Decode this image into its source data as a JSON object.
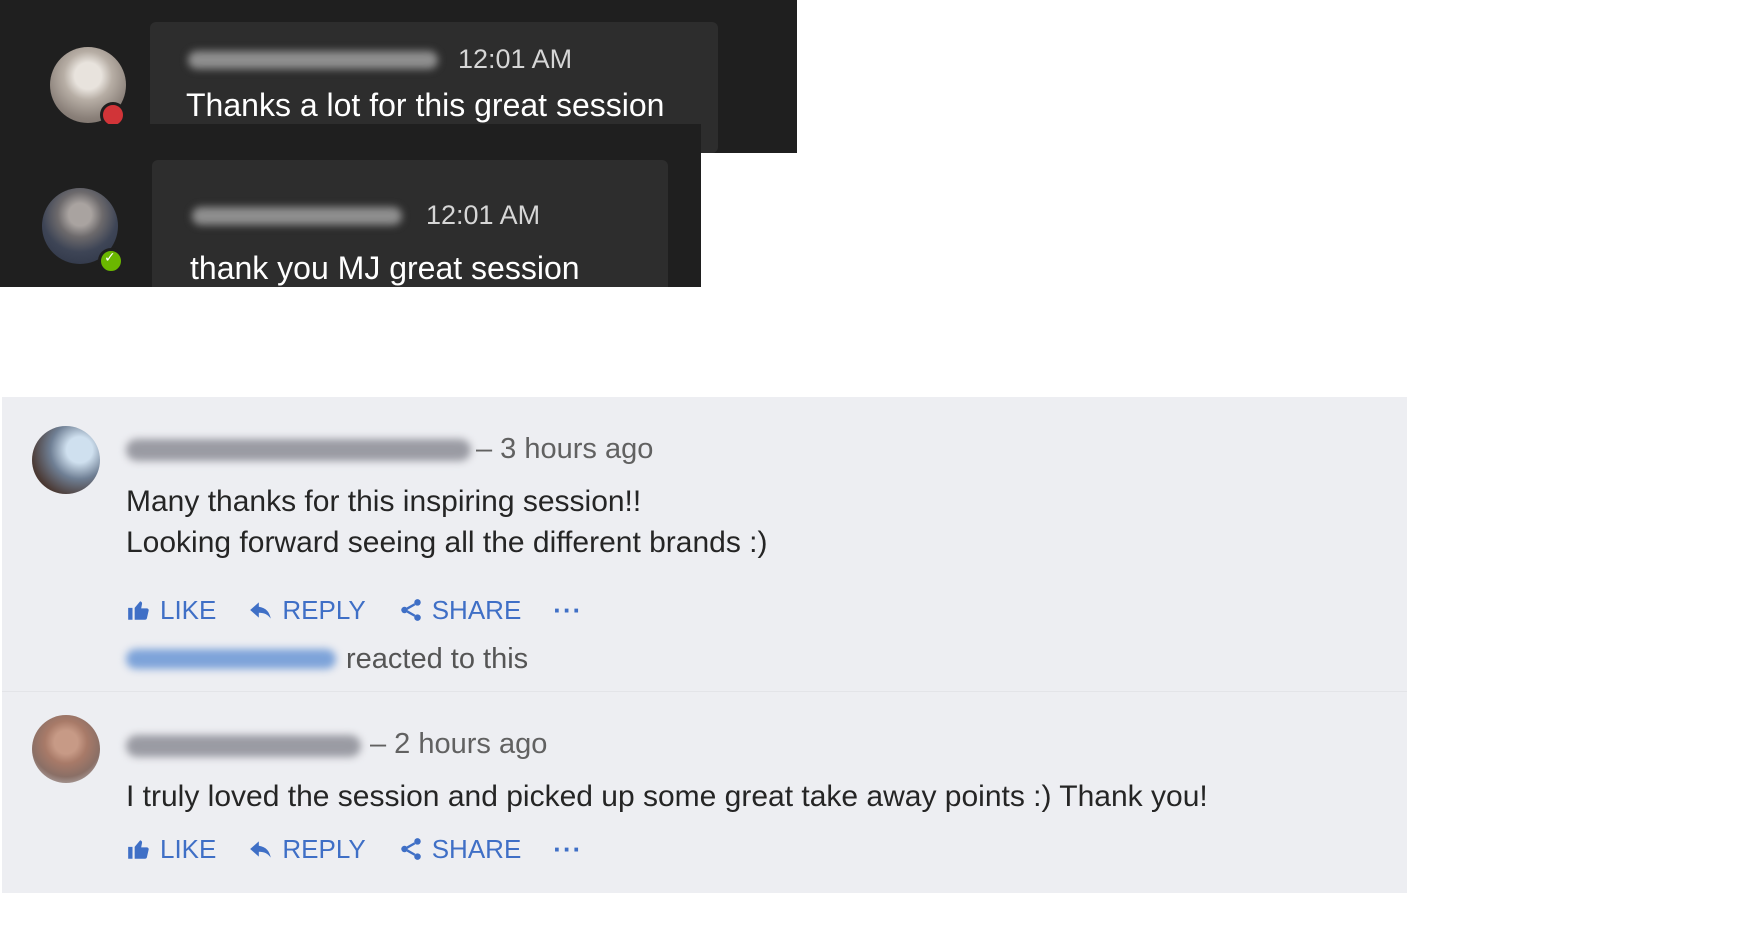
{
  "chat": [
    {
      "time": "12:01 AM",
      "text": "Thanks a lot for this great session",
      "presence": "busy",
      "presence_color": "#d13438"
    },
    {
      "time": "12:01 AM",
      "text": "thank you MJ great session",
      "presence": "available",
      "presence_color": "#6bb700"
    }
  ],
  "comments": [
    {
      "time": "– 3 hours ago",
      "lines": [
        "Many thanks for this inspiring session!!",
        "Looking forward seeing all the different brands :)"
      ],
      "actions": {
        "like": "LIKE",
        "reply": "REPLY",
        "share": "SHARE",
        "more": "···"
      },
      "reaction_text": "reacted to this"
    },
    {
      "time": "– 2 hours ago",
      "lines": [
        "I truly loved the session and picked up some great take away points :) Thank you!"
      ],
      "actions": {
        "like": "LIKE",
        "reply": "REPLY",
        "share": "SHARE",
        "more": "···"
      }
    }
  ],
  "icons": {
    "like": "thumbs-up-icon",
    "reply": "reply-arrow-icon",
    "share": "share-icon",
    "more": "more-dots-icon"
  },
  "colors": {
    "accent": "#3f6fc6",
    "chat_bg": "#1f1f1f",
    "bubble_bg": "#2d2d2d",
    "thread_bg": "#edeef2"
  }
}
